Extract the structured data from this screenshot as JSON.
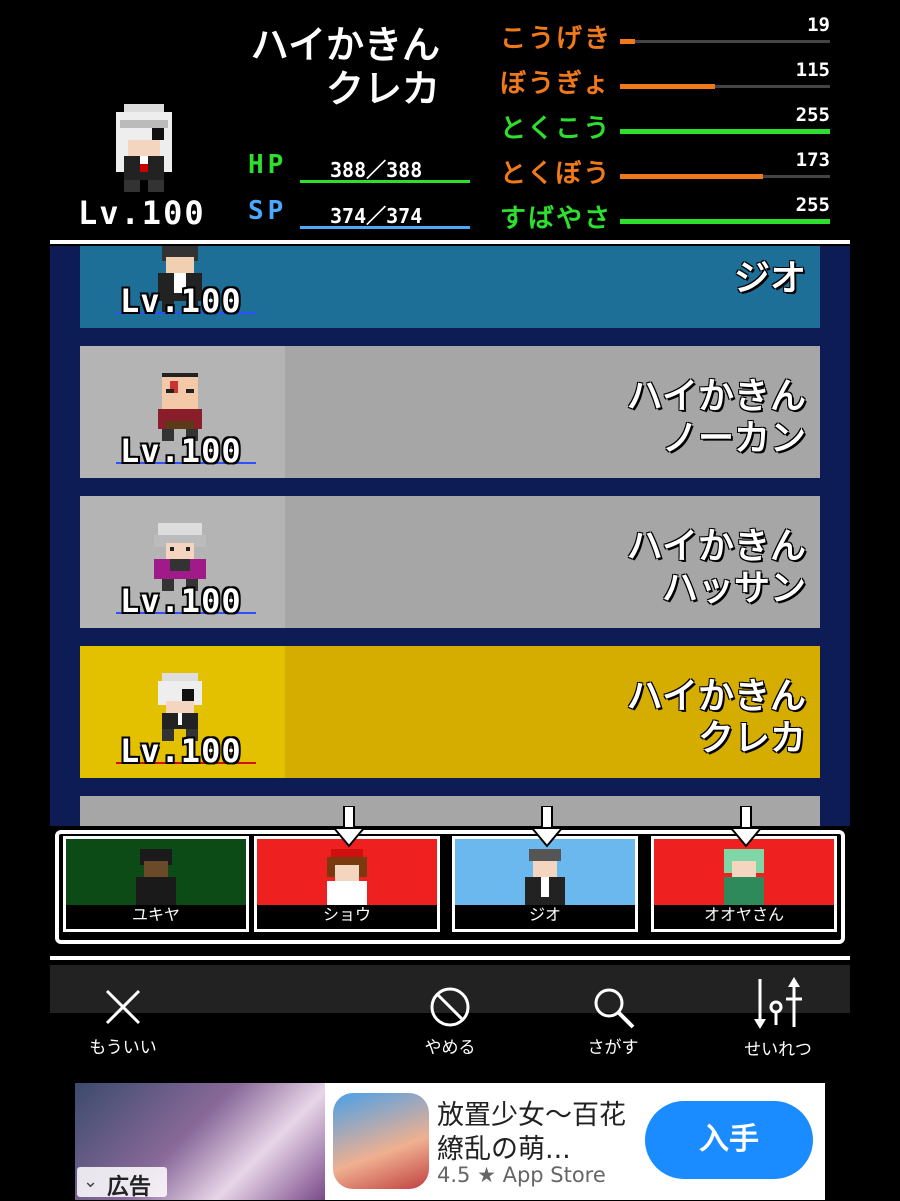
{
  "status": {
    "name_line1": "ハイかきん",
    "name_line2": "クレカ",
    "level": "Lv.100",
    "hp_label": "HP",
    "hp_value": "388／388",
    "hp_fraction": 1.0,
    "sp_label": "SP",
    "sp_value": "374／374",
    "sp_fraction": 1.0,
    "stats": [
      {
        "label": "こうげき",
        "value": "19",
        "fraction": 0.07,
        "color": "#f07a1a"
      },
      {
        "label": "ぼうぎょ",
        "value": "115",
        "fraction": 0.45,
        "color": "#f07a1a"
      },
      {
        "label": "とくこう",
        "value": "255",
        "fraction": 1.0,
        "color": "#2ee02e"
      },
      {
        "label": "とくぼう",
        "value": "173",
        "fraction": 0.68,
        "color": "#f07a1a"
      },
      {
        "label": "すばやさ",
        "value": "255",
        "fraction": 1.0,
        "color": "#2ee02e"
      }
    ]
  },
  "list": {
    "cards": [
      {
        "name_line1": "",
        "name_line2": "ジオ",
        "level": "Lv.100",
        "color": "#1d6f98",
        "left_color": "#1d6f98"
      },
      {
        "name_line1": "ハイかきん",
        "name_line2": "ノーカン",
        "level": "Lv.100",
        "color": "#a6a6a6",
        "left_color": "#b4b4b4"
      },
      {
        "name_line1": "ハイかきん",
        "name_line2": "ハッサン",
        "level": "Lv.100",
        "color": "#a6a6a6",
        "left_color": "#b4b4b4"
      },
      {
        "name_line1": "ハイかきん",
        "name_line2": "クレカ",
        "level": "Lv.100",
        "color": "#d4ad00",
        "left_color": "#e3c000"
      }
    ]
  },
  "party": [
    {
      "name": "ユキヤ",
      "color": "#0c4a16",
      "selected": false
    },
    {
      "name": "ショウ",
      "color": "#ef2020",
      "selected": true
    },
    {
      "name": "ジオ",
      "color": "#6ab8ee",
      "selected": true
    },
    {
      "name": "オオヤさん",
      "color": "#ef2020",
      "selected": true
    }
  ],
  "toolbar": {
    "close_label": "もういい",
    "cancel_label": "やめる",
    "search_label": "さがす",
    "sort_label": "せいれつ"
  },
  "ad": {
    "tag": "広告",
    "title_line1": "放置少女～百花",
    "title_line2": "繚乱の萌...",
    "rating": "4.5 ★ App Store",
    "button": "入手"
  },
  "colors": {
    "hp_label": "#2ee02e",
    "sp_label": "#4aa8ff",
    "ad_button": "#1a8cff"
  }
}
